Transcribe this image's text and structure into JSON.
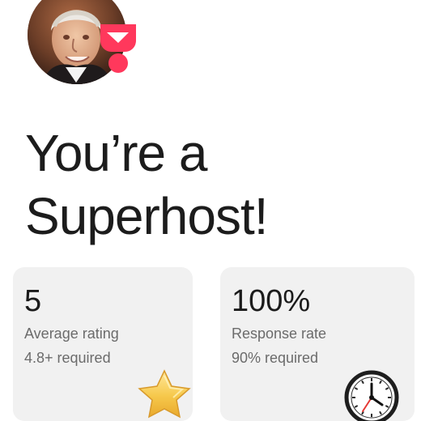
{
  "profile": {
    "avatar_icon": "host-photo",
    "badge_icon": "superhost-badge-icon",
    "badge_color": "#ff385c"
  },
  "page": {
    "title": "You’re a Superhost!"
  },
  "stats": [
    {
      "value": "5",
      "label": "Average rating",
      "requirement": "4.8+ required",
      "icon": "star-icon"
    },
    {
      "value": "100%",
      "label": "Response rate",
      "requirement": "90% required",
      "icon": "clock-icon"
    }
  ],
  "colors": {
    "background": "#ffffff",
    "card_background": "#f1f1f1",
    "text_primary": "#1c1c1c",
    "text_secondary": "#6b6b6b",
    "accent": "#ff385c",
    "star": "#f6c84b"
  }
}
